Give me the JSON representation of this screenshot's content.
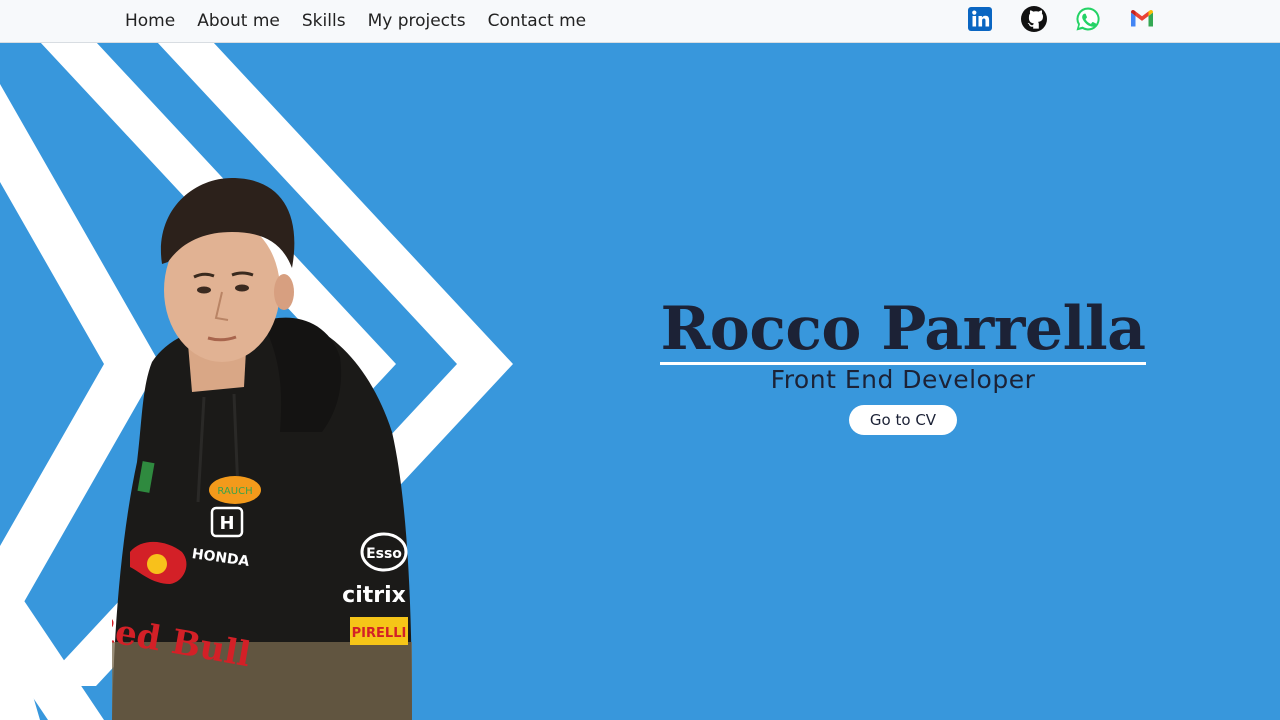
{
  "nav": {
    "links": [
      {
        "label": "Home"
      },
      {
        "label": "About me"
      },
      {
        "label": "Skills"
      },
      {
        "label": "My projects"
      },
      {
        "label": "Contact me"
      }
    ],
    "social": [
      {
        "icon": "linkedin-icon",
        "color": "#0a66c2"
      },
      {
        "icon": "github-icon",
        "color": "#111111"
      },
      {
        "icon": "whatsapp-icon",
        "color": "#25d366"
      },
      {
        "icon": "gmail-icon",
        "color": "#ea4335"
      }
    ]
  },
  "hero": {
    "name": "Rocco Parrella",
    "role": "Front End Developer",
    "cv_button": "Go to CV"
  },
  "photo": {
    "hoodie_text": [
      "Red Bull",
      "HONDA",
      "RAUCH",
      "Esso",
      "citrix",
      "PIRELLI"
    ]
  },
  "colors": {
    "background": "#3897dc",
    "navbar": "#f7f9fb",
    "text": "#1c2236",
    "chevron": "#ffffff"
  }
}
